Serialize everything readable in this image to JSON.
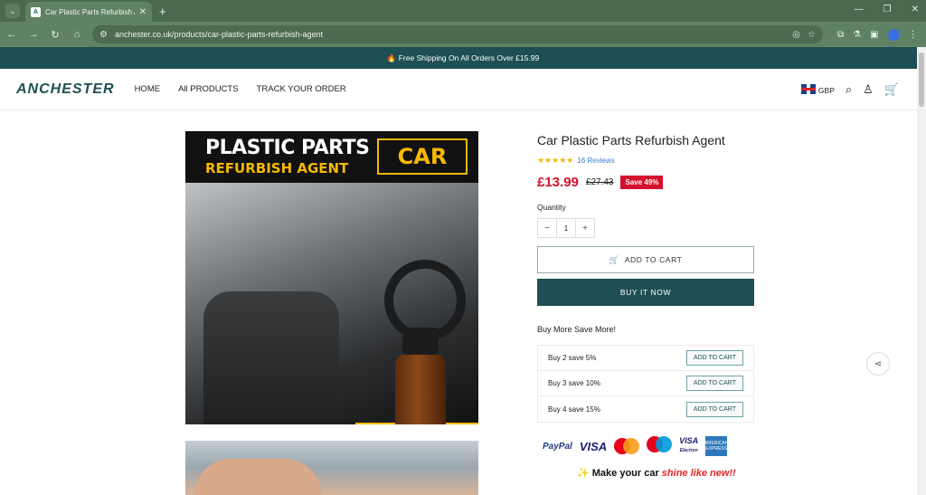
{
  "browser": {
    "tab_title": "Car Plastic Parts Refurbish Agen",
    "tab_close": "✕",
    "new_tab": "+",
    "url": "anchester.co.uk/products/car-plastic-parts-refurbish-agent",
    "window_controls": [
      "—",
      "❐",
      "✕"
    ]
  },
  "announcement": "🔥 Free Shipping On All Orders Over £15.99",
  "header": {
    "logo": "ANCHESTER",
    "nav": [
      "HOME",
      "All PRODUCTS",
      "TRACK YOUR ORDER"
    ],
    "currency": "GBP"
  },
  "product_image": {
    "title_line1": "PLASTIC PARTS",
    "title_line2": "REFURBISH AGENT",
    "tag": "CAR"
  },
  "product": {
    "title": "Car Plastic Parts Refurbish Agent",
    "stars": "★★★★★",
    "reviews": "16 Reviews",
    "price": "£13.99",
    "compare_price": "£27.43",
    "save_badge": "Save 49%",
    "quantity_label": "Quantity",
    "quantity_value": "1",
    "qty_minus": "−",
    "qty_plus": "+",
    "add_to_cart": "ADD TO CART",
    "buy_now": "BUY IT NOW",
    "bundle_heading": "Buy More Save More!",
    "tiers": [
      {
        "label": "Buy 2 save 5%",
        "button": "ADD TO CART"
      },
      {
        "label": "Buy 3 save 10%",
        "button": "ADD TO CART"
      },
      {
        "label": "Buy 4 save 15%",
        "button": "ADD TO CART"
      }
    ],
    "payments": {
      "paypal": "PayPal",
      "visa": "VISA",
      "visa_electron_1": "VISA",
      "visa_electron_2": "Electron",
      "amex": "AMERICAN EXPRESS"
    },
    "slogan_prefix": "✨ Make your car ",
    "slogan_highlight": "shine like new!!"
  },
  "colors": {
    "brand": "#1e4f54",
    "sale": "#d6102c",
    "star": "#f5b301",
    "browser_frame": "#5f8264"
  }
}
